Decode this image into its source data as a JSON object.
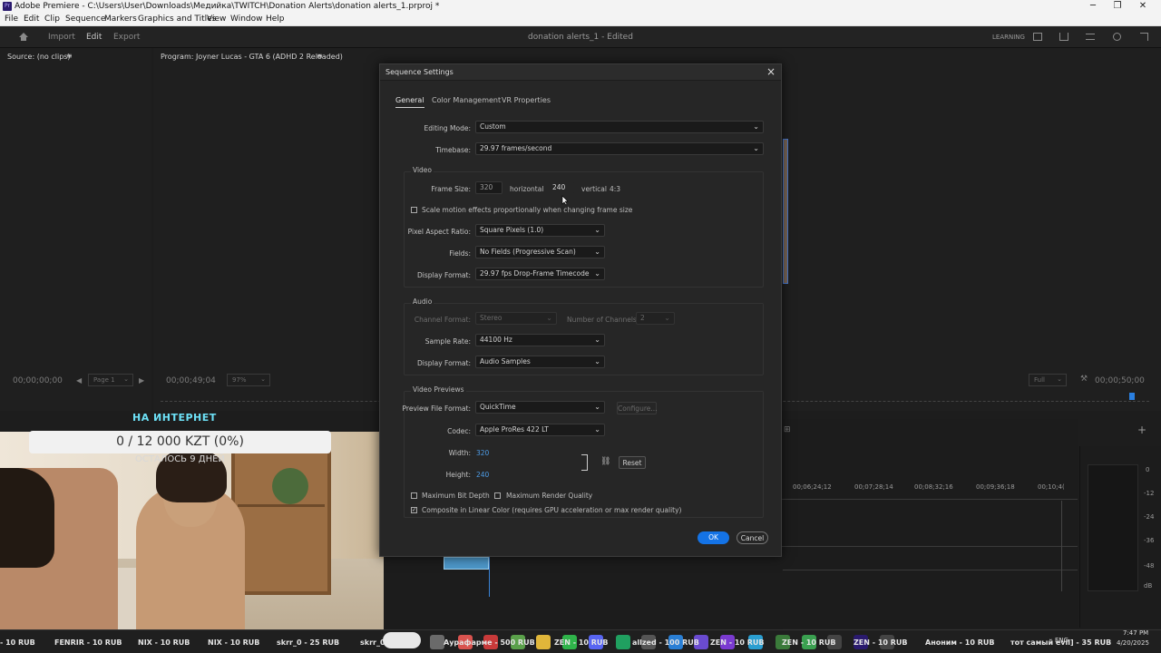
{
  "titlebar": {
    "app_title": "Adobe Premiere - C:\\Users\\User\\Downloads\\Медийка\\TWITCH\\Donation Alerts\\donation alerts_1.prproj *",
    "minimize": "─",
    "maximize": "❐",
    "close": "✕"
  },
  "menu": [
    "File",
    "Edit",
    "Clip",
    "Sequence",
    "Markers",
    "Graphics and Titles",
    "View",
    "Window",
    "Help"
  ],
  "workspace": {
    "tabs": [
      "Import",
      "Edit",
      "Export"
    ],
    "active_tab": "Edit",
    "document": "donation alerts_1 - Edited",
    "learning": "LEARNING"
  },
  "source_panel": {
    "title": "Source: (no clips)",
    "timecode": "00;00;00;00",
    "page": "Page 1"
  },
  "program_panel": {
    "title": "Program: Joyner Lucas - GTA 6 (ADHD 2 Reloaded)",
    "timecode_left": "00;00;49;04",
    "zoom": "97%",
    "fit": "Full",
    "timecode_right": "00;00;50;00"
  },
  "timeline": {
    "ruler": [
      "00;06;24;12",
      "00;07;28;14",
      "00;08;32;16",
      "00;09;36;18",
      "00;10;4("
    ]
  },
  "meter": {
    "scale": [
      "0",
      "-12",
      "-24",
      "-36",
      "-48",
      "dB"
    ]
  },
  "dialog": {
    "title": "Sequence Settings",
    "tabs": [
      "General",
      "Color Management",
      "VR Properties"
    ],
    "active_tab": "General",
    "editing_mode_label": "Editing Mode:",
    "editing_mode": "Custom",
    "timebase_label": "Timebase:",
    "timebase": "29.97  frames/second",
    "video_section": "Video",
    "frame_size_label": "Frame Size:",
    "frame_width": "320",
    "horizontal": "horizontal",
    "frame_height": "240",
    "vertical": "vertical",
    "aspect": "4:3",
    "scale_motion": "Scale motion effects proportionally when changing frame size",
    "scale_motion_checked": false,
    "par_label": "Pixel Aspect Ratio:",
    "par": "Square Pixels (1.0)",
    "fields_label": "Fields:",
    "fields": "No Fields (Progressive Scan)",
    "display_format_label": "Display Format:",
    "video_display_format": "29.97 fps Drop-Frame Timecode",
    "audio_section": "Audio",
    "channel_format_label": "Channel Format:",
    "channel_format": "Stereo",
    "num_channels_label": "Number of Channels:",
    "num_channels": "2",
    "sample_rate_label": "Sample Rate:",
    "sample_rate": "44100 Hz",
    "audio_display_format": "Audio Samples",
    "previews_section": "Video Previews",
    "preview_format_label": "Preview File Format:",
    "preview_format": "QuickTime",
    "configure": "Configure...",
    "codec_label": "Codec:",
    "codec": "Apple ProRes 422 LT",
    "width_label": "Width:",
    "width": "320",
    "height_label": "Height:",
    "height": "240",
    "reset": "Reset",
    "max_bit_depth": "Maximum Bit Depth",
    "max_bit_depth_checked": false,
    "max_render_quality": "Maximum Render Quality",
    "max_render_quality_checked": false,
    "composite_linear": "Composite in Linear Color (requires GPU acceleration or max render quality)",
    "composite_linear_checked": true,
    "ok": "OK",
    "cancel": "Cancel"
  },
  "stream_overlay": {
    "goal_title": "НА ИНТЕРНЕТ",
    "goal_progress_text": "0 / 12 000 KZT (0%)",
    "goal_progress": 0,
    "goal_remaining": "ОСТАЛОСЬ 9 ДНЕЙ"
  },
  "ticker": [
    "- 10 RUB",
    "FENRIR - 10 RUB",
    "NIX - 10 RUB",
    "NIX - 10 RUB",
    "skrr_0 - 25 RUB",
    "skrr_0",
    "Аурафарме - 500 RUB",
    "ZEN - 10 RUB",
    "allzed - 100 RUB",
    "ZEN - 10 RUB",
    "ZEN - 10 RUB",
    "ZEN - 10 RUB",
    "Аноним - 10 RUB",
    "тот самый evil] - 35 RUB"
  ],
  "tray": {
    "lang": "ENG",
    "time": "7:47 PM",
    "date": "4/20/2025"
  }
}
